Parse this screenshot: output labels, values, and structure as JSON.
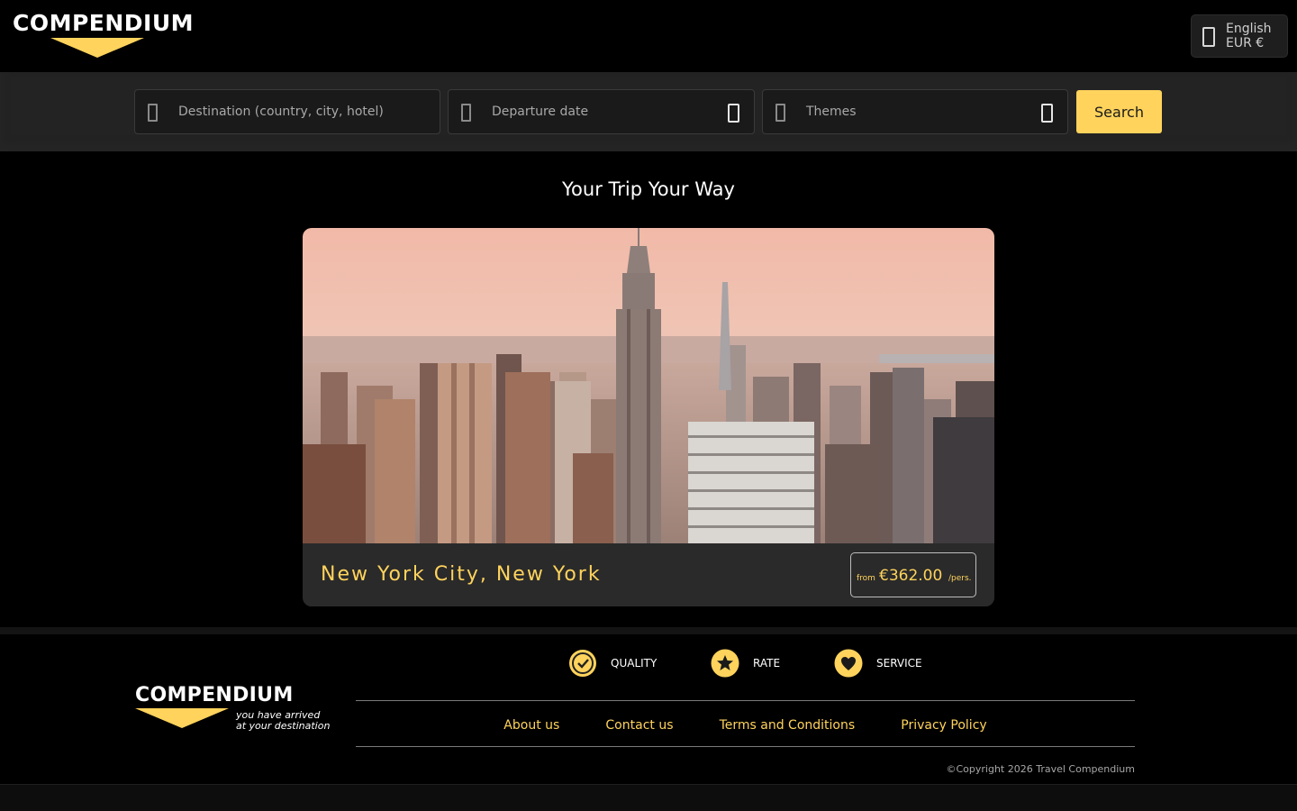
{
  "header": {
    "logo_text": "COMPENDIUM",
    "language": "English",
    "currency": "EUR €"
  },
  "search": {
    "destination_placeholder": "Destination (country, city, hotel)",
    "departure_placeholder": "Departure date",
    "themes_label": "Themes",
    "search_label": "Search"
  },
  "main": {
    "title": "Your Trip Your Way",
    "card": {
      "title": "New York City, New York",
      "price_from": "from",
      "price": "€362.00",
      "price_per": "/pers."
    }
  },
  "footer": {
    "logo_text": "COMPENDIUM",
    "tagline_1": "you have arrived",
    "tagline_2": "at your destination",
    "badges": [
      {
        "label": "QUALITY",
        "icon": "check-badge-icon"
      },
      {
        "label": "RATE",
        "icon": "star-icon"
      },
      {
        "label": "SERVICE",
        "icon": "heart-icon"
      }
    ],
    "links": [
      "About us",
      "Contact us",
      "Terms and Conditions",
      "Privacy Policy"
    ],
    "copyright": "©Copyright 2026 Travel Compendium"
  },
  "colors": {
    "accent": "#ffd35c",
    "background": "#000000",
    "search_strip": "#232323"
  }
}
